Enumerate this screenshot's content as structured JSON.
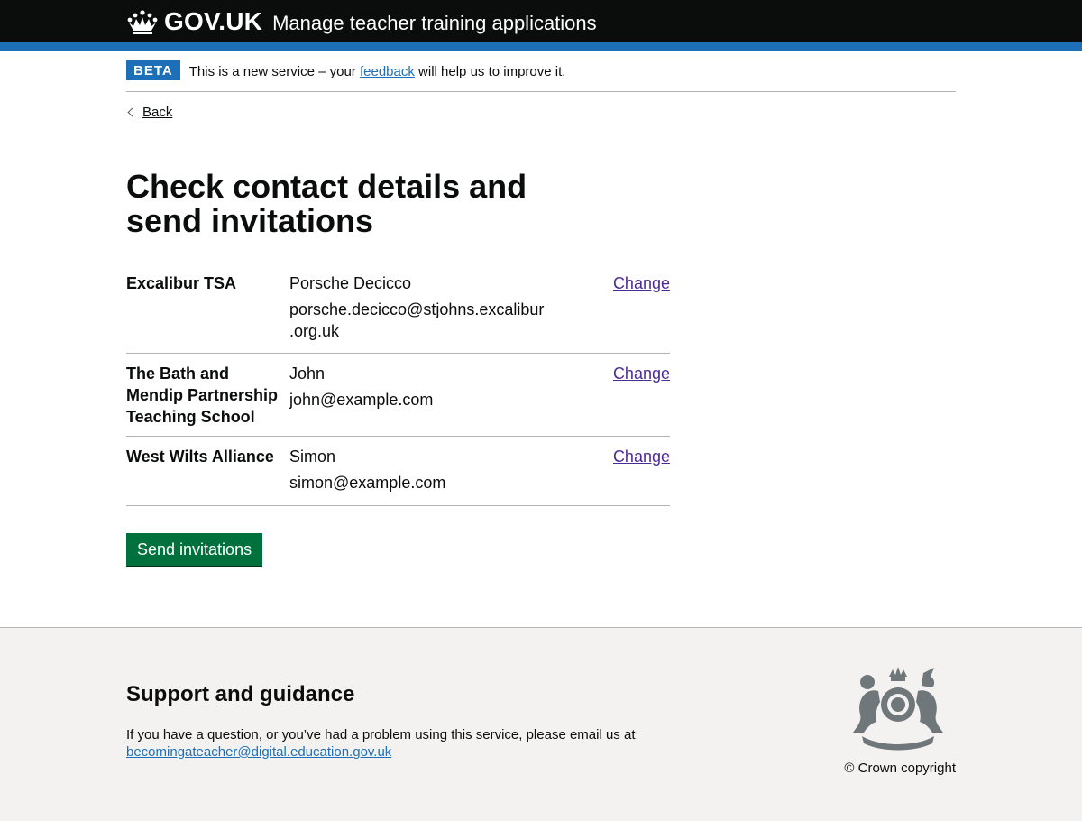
{
  "header": {
    "logo_text": "GOV.UK",
    "service_name": "Manage teacher training applications"
  },
  "phase_banner": {
    "tag": "BETA",
    "text_before": "This is a new service – your ",
    "link": "feedback",
    "text_after": " will help us to improve it."
  },
  "back_link": "Back",
  "page_title": "Check contact details and send invitations",
  "summary": {
    "rows": [
      {
        "key": "Excalibur TSA",
        "name": "Porsche Decicco",
        "email_line1": "porsche.decicco@stjohns.excalibur",
        "email_line2": ".org.uk",
        "action": "Change"
      },
      {
        "key_line1": "The Bath and",
        "key_line2": "Mendip Partnership",
        "key_line3": "Teaching School",
        "name": "John",
        "email": "john@example.com",
        "action": "Change"
      },
      {
        "key": "West Wilts Alliance",
        "name": "Simon",
        "email": "simon@example.com",
        "action": "Change"
      }
    ]
  },
  "submit_button": "Send invitations",
  "footer": {
    "heading": "Support and guidance",
    "help_text": "If you have a question, or you’ve had a problem using this service, please email us at",
    "email_link": "becomingateacher@digital.education.gov.uk",
    "copyright": "© Crown copyright"
  },
  "icons": [
    "crown-icon",
    "back-chevron-icon",
    "royal-crest-icon"
  ],
  "colors": {
    "header_bg": "#0b0c0c",
    "brand_blue": "#1d70b8",
    "button_green": "#00703c",
    "visited_link": "#4c2c92",
    "footer_bg": "#f3f2f1"
  }
}
